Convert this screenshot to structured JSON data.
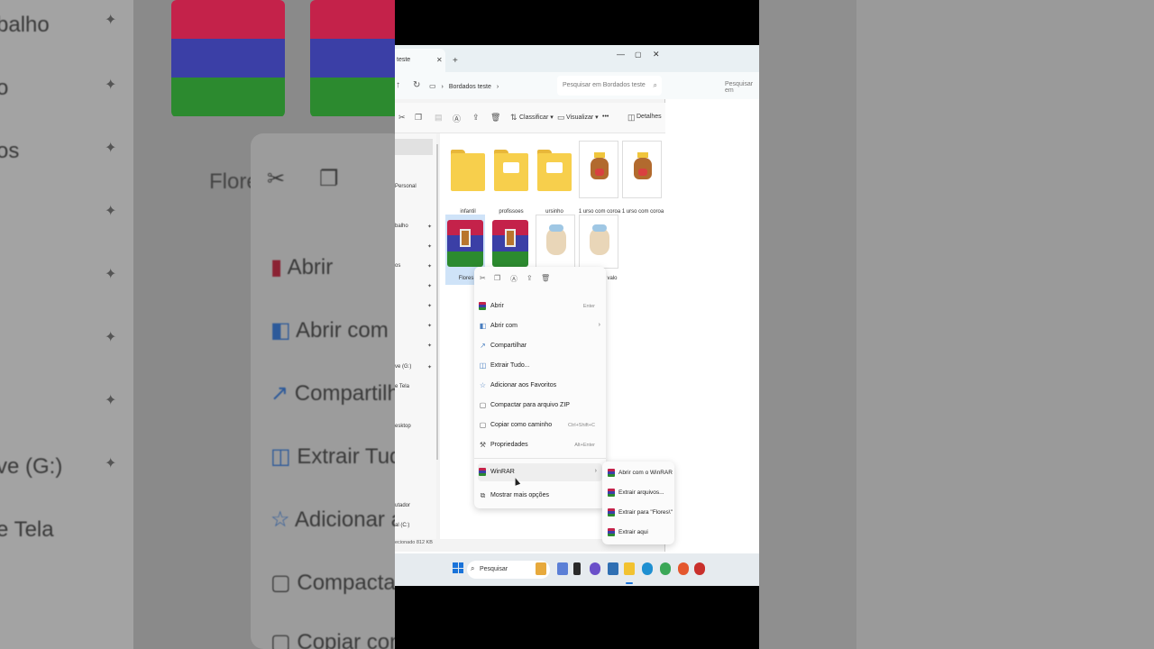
{
  "background": {
    "left_labels": [
      "balho",
      "o",
      "os",
      "ve (G:)",
      "e Tela"
    ],
    "left_items": [
      "Abrir",
      "Abrir com",
      "Compartilha",
      "Extrair Tudo",
      "Adicionar ao",
      "Compactar",
      "Copiar com"
    ],
    "left_file_label": "Flores",
    "right_search": "Pesquisar em"
  },
  "window": {
    "tab_title": "teste",
    "breadcrumb": "Bordados teste",
    "search_placeholder": "Pesquisar em Bordados teste",
    "toolbar": {
      "sort_label": "Classificar",
      "view_label": "Visualizar",
      "more_label": "•••",
      "details_label": "Detalhes"
    },
    "nav_items": [
      "Personal",
      "balho",
      "os",
      "ve (G:)",
      "e Tela",
      "esktop",
      "utador",
      "al (C:)"
    ],
    "files": [
      {
        "name": "infantil",
        "type": "folder"
      },
      {
        "name": "profissoes",
        "type": "folder"
      },
      {
        "name": "ursinho",
        "type": "folder"
      },
      {
        "name": "1 urso com coroa",
        "type": "image"
      },
      {
        "name": "1 urso com coroa",
        "type": "image"
      },
      {
        "name": "Flores",
        "type": "rar"
      },
      {
        "name": "",
        "type": "rar"
      },
      {
        "name": "",
        "type": "image"
      },
      {
        "name": "valo",
        "type": "image"
      }
    ],
    "status": "ecionado 812 KB"
  },
  "context_menu": {
    "items": [
      {
        "label": "Abrir",
        "shortcut": "Enter",
        "icon": "winrar-icon"
      },
      {
        "label": "Abrir com",
        "shortcut": "",
        "icon": "open-with-icon"
      },
      {
        "label": "Compartilhar",
        "shortcut": "",
        "icon": "share-icon"
      },
      {
        "label": "Extrair Tudo...",
        "shortcut": "",
        "icon": "extract-icon"
      },
      {
        "label": "Adicionar aos Favoritos",
        "shortcut": "",
        "icon": "star-icon"
      },
      {
        "label": "Compactar para arquivo ZIP",
        "shortcut": "",
        "icon": "zip-icon"
      },
      {
        "label": "Copiar como caminho",
        "shortcut": "Ctrl+Shift+C",
        "icon": "path-icon"
      },
      {
        "label": "Propriedades",
        "shortcut": "Alt+Enter",
        "icon": "wrench-icon"
      }
    ],
    "winrar_label": "WinRAR",
    "more_options_label": "Mostrar mais opções"
  },
  "submenu": {
    "items": [
      "Abrir com o WinRAR",
      "Extrair arquivos...",
      "Extrair para \"Flores\\\"",
      "Extrair aqui"
    ]
  },
  "taskbar": {
    "search_label": "Pesquisar"
  },
  "colors": {
    "accent": "#1a73d9",
    "rar_red": "#c4224a",
    "rar_blue": "#3b3fa6",
    "rar_green": "#2c8a2f",
    "folder": "#f7cf4c"
  }
}
